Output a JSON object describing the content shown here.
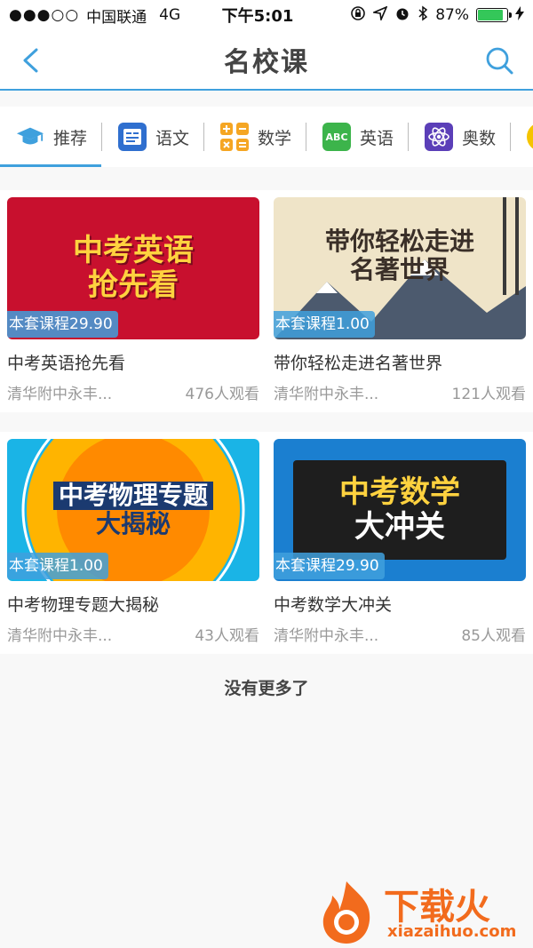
{
  "status": {
    "carrier": "中国联通",
    "network": "4G",
    "time": "下午5:01",
    "battery": "87%",
    "battery_level": 0.87
  },
  "nav": {
    "title": "名校课"
  },
  "tabs": [
    {
      "label": "推荐",
      "icon": "graduation-cap-icon"
    },
    {
      "label": "语文",
      "icon": "chinese-book-icon"
    },
    {
      "label": "数学",
      "icon": "math-symbols-icon"
    },
    {
      "label": "英语",
      "icon": "abc-icon",
      "icon_text": "ABC"
    },
    {
      "label": "奥数",
      "icon": "atom-icon"
    }
  ],
  "courses": [
    {
      "title": "中考英语抢先看",
      "price": "本套课程29.90",
      "school": "清华附中永丰...",
      "views": "476人观看",
      "banner": [
        "中考英语",
        "抢先看"
      ]
    },
    {
      "title": "带你轻松走进名著世界",
      "price": "本套课程1.00",
      "school": "清华附中永丰...",
      "views": "121人观看",
      "banner": [
        "带你轻松走进",
        "名著世界"
      ]
    },
    {
      "title": "中考物理专题大揭秘",
      "price": "本套课程1.00",
      "school": "清华附中永丰...",
      "views": "43人观看",
      "banner": [
        "中考物理专题",
        "大揭秘"
      ]
    },
    {
      "title": "中考数学大冲关",
      "price": "本套课程29.90",
      "school": "清华附中永丰...",
      "views": "85人观看",
      "banner": [
        "中考数学",
        "大冲关"
      ]
    }
  ],
  "footer": {
    "no_more": "没有更多了"
  },
  "watermark": {
    "brand": "下载火",
    "site": "xiazaihuo.com"
  },
  "colors": {
    "accent": "#3fa0dd",
    "english_banner": "#c8102e",
    "novel_banner": "#efe4c8",
    "physics_banner": "#1ab4e6",
    "math_banner": "#1b7fd0"
  }
}
